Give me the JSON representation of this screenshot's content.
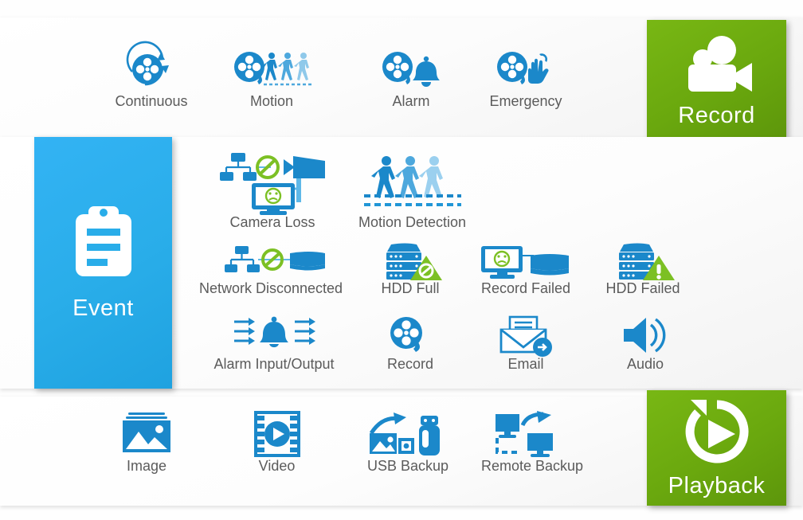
{
  "colors": {
    "blue": "#1b88ca",
    "blue_light": "#2196d6",
    "blue_pale": "#8fc9ea",
    "blue_mid": "#4da8dd",
    "green": "#6aa80e",
    "green_bright": "#7cc024",
    "event_blue": "#29ade9",
    "label_gray": "#5b5b5b",
    "panel_white": "#fdfdfd"
  },
  "record_row": {
    "tile": {
      "label": "Record",
      "icon": "video-camera-icon",
      "color": "#6aa80e"
    },
    "items": [
      {
        "label": "Continuous",
        "icon": "film-reel-refresh-icon"
      },
      {
        "label": "Motion",
        "icon": "film-reel-people-icon"
      },
      {
        "label": "Alarm",
        "icon": "film-reel-bell-icon"
      },
      {
        "label": "Emergency",
        "icon": "film-reel-hand-icon"
      }
    ]
  },
  "event_section": {
    "tile": {
      "label": "Event",
      "icon": "clipboard-icon",
      "color": "#29ade9"
    },
    "rows": [
      [
        {
          "label": "Camera Loss",
          "icon": "camera-loss-icon"
        },
        {
          "label": "Motion Detection",
          "icon": "motion-detection-icon"
        }
      ],
      [
        {
          "label": "Network Disconnected",
          "icon": "network-disconnected-icon"
        },
        {
          "label": "HDD Full",
          "icon": "hdd-full-icon"
        },
        {
          "label": "Record Failed",
          "icon": "record-failed-icon"
        },
        {
          "label": "HDD Failed",
          "icon": "hdd-failed-icon"
        }
      ],
      [
        {
          "label": "Alarm Input/Output",
          "icon": "alarm-io-bell-icon"
        },
        {
          "label": "Record",
          "icon": "film-reel-icon"
        },
        {
          "label": "Email",
          "icon": "email-send-icon"
        },
        {
          "label": "Audio",
          "icon": "speaker-icon"
        }
      ]
    ]
  },
  "playback_row": {
    "tile": {
      "label": "Playback",
      "icon": "replay-play-icon",
      "color": "#6aa80e"
    },
    "items": [
      {
        "label": "Image",
        "icon": "photo-icon"
      },
      {
        "label": "Video",
        "icon": "film-play-icon"
      },
      {
        "label": "USB Backup",
        "icon": "usb-backup-icon"
      },
      {
        "label": "Remote Backup",
        "icon": "remote-backup-icon"
      }
    ]
  }
}
